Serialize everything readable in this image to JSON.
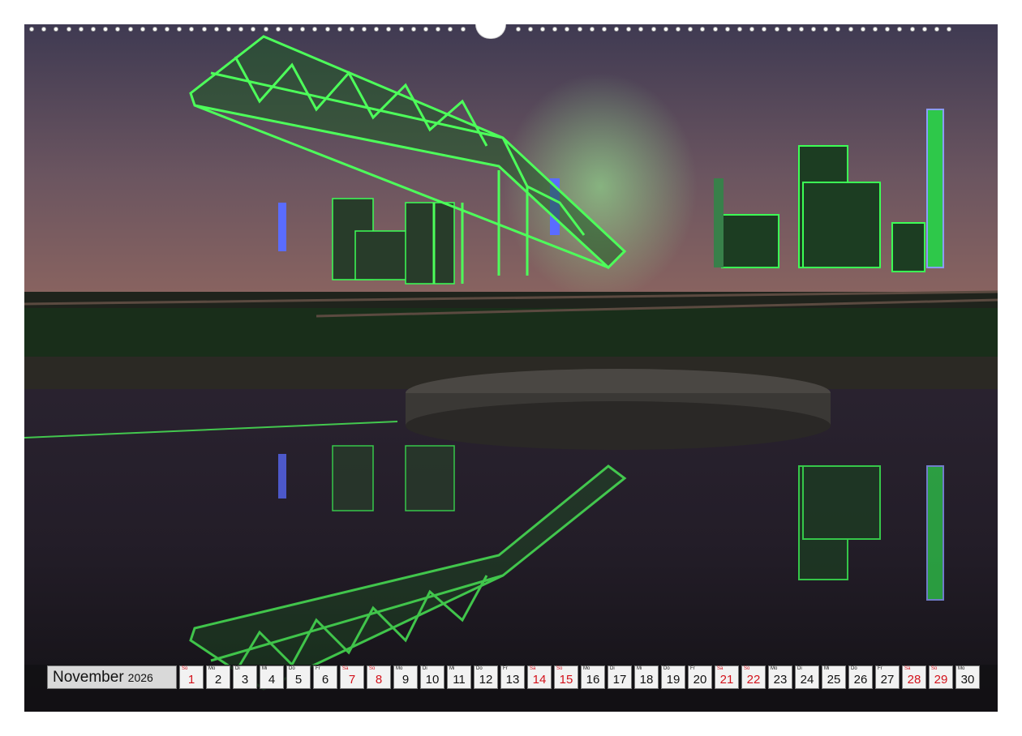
{
  "calendar": {
    "month": "November",
    "year": "2026",
    "days": [
      {
        "wd": "So",
        "n": "1",
        "red": true
      },
      {
        "wd": "Mo",
        "n": "2",
        "red": false
      },
      {
        "wd": "Di",
        "n": "3",
        "red": false
      },
      {
        "wd": "Mi",
        "n": "4",
        "red": false
      },
      {
        "wd": "Do",
        "n": "5",
        "red": false
      },
      {
        "wd": "Fr",
        "n": "6",
        "red": false
      },
      {
        "wd": "Sa",
        "n": "7",
        "red": true
      },
      {
        "wd": "So",
        "n": "8",
        "red": true
      },
      {
        "wd": "Mo",
        "n": "9",
        "red": false
      },
      {
        "wd": "Di",
        "n": "10",
        "red": false
      },
      {
        "wd": "Mi",
        "n": "11",
        "red": false
      },
      {
        "wd": "Do",
        "n": "12",
        "red": false
      },
      {
        "wd": "Fr",
        "n": "13",
        "red": false
      },
      {
        "wd": "Sa",
        "n": "14",
        "red": true
      },
      {
        "wd": "So",
        "n": "15",
        "red": true
      },
      {
        "wd": "Mo",
        "n": "16",
        "red": false
      },
      {
        "wd": "Di",
        "n": "17",
        "red": false
      },
      {
        "wd": "Mi",
        "n": "18",
        "red": false
      },
      {
        "wd": "Do",
        "n": "19",
        "red": false
      },
      {
        "wd": "Fr",
        "n": "20",
        "red": false
      },
      {
        "wd": "Sa",
        "n": "21",
        "red": true
      },
      {
        "wd": "So",
        "n": "22",
        "red": true
      },
      {
        "wd": "Mo",
        "n": "23",
        "red": false
      },
      {
        "wd": "Di",
        "n": "24",
        "red": false
      },
      {
        "wd": "Mi",
        "n": "25",
        "red": false
      },
      {
        "wd": "Do",
        "n": "26",
        "red": false
      },
      {
        "wd": "Fr",
        "n": "27",
        "red": false
      },
      {
        "wd": "Sa",
        "n": "28",
        "red": true
      },
      {
        "wd": "So",
        "n": "29",
        "red": true
      },
      {
        "wd": "Mo",
        "n": "30",
        "red": false
      }
    ]
  },
  "colors": {
    "weekend": "#d3121b",
    "weekday": "#111111",
    "glow_green": "#39ff4a",
    "glow_blue": "#5a6cff"
  },
  "photo": {
    "icon": "industrial-night-scene"
  }
}
